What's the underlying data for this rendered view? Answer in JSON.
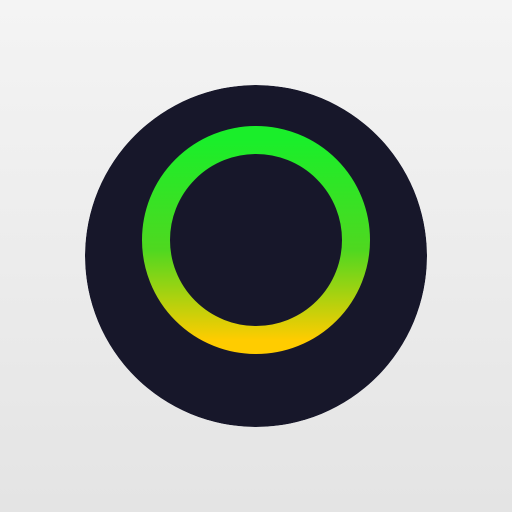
{
  "icon": {
    "name": "ring-icon",
    "colors": {
      "background_top": "#f4f4f4",
      "background_bottom": "#e4e4e4",
      "disc": "#17172a",
      "ring_top": "#1aee2a",
      "ring_middle": "#4fd820",
      "ring_bottom": "#ffcc00"
    }
  }
}
